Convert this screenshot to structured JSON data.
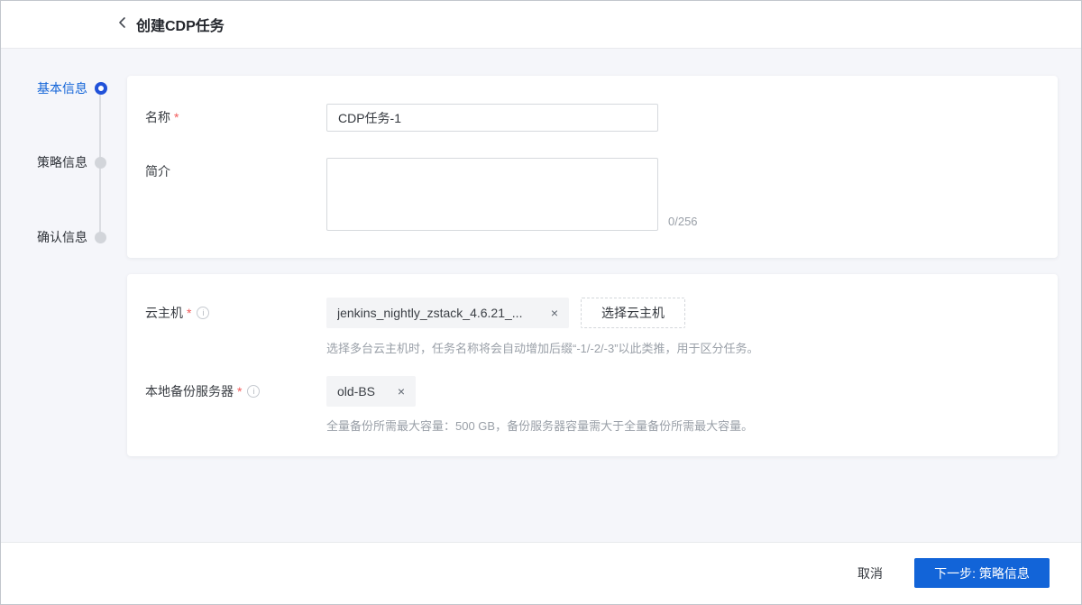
{
  "header": {
    "title": "创建CDP任务"
  },
  "stepper": {
    "steps": [
      {
        "label": "基本信息",
        "state": "active"
      },
      {
        "label": "策略信息",
        "state": "pending"
      },
      {
        "label": "确认信息",
        "state": "pending"
      }
    ]
  },
  "basic_card": {
    "name_label": "名称",
    "required_mark": "*",
    "name_value": "CDP任务-1",
    "desc_label": "简介",
    "desc_value": "",
    "desc_counter": "0/256"
  },
  "resource_card": {
    "vm_label": "云主机",
    "vm_required_mark": "*",
    "vm_tag": "jenkins_nightly_zstack_4.6.21_...",
    "vm_tag_close": "×",
    "select_vm_button": "选择云主机",
    "vm_help": "选择多台云主机时，任务名称将会自动增加后缀“-1/-2/-3”以此类推，用于区分任务。",
    "bs_label": "本地备份服务器",
    "bs_required_mark": "*",
    "bs_tag": "old-BS",
    "bs_tag_close": "×",
    "bs_help": "全量备份所需最大容量：500 GB，备份服务器容量需大于全量备份所需最大容量。"
  },
  "footer": {
    "cancel_label": "取消",
    "next_label": "下一步: 策略信息"
  },
  "colors": {
    "accent": "#1264d8",
    "required": "#f25a5a",
    "helper_text": "#9aa0a8",
    "tag_bg": "#f3f4f6",
    "content_bg": "#f5f6fa"
  }
}
